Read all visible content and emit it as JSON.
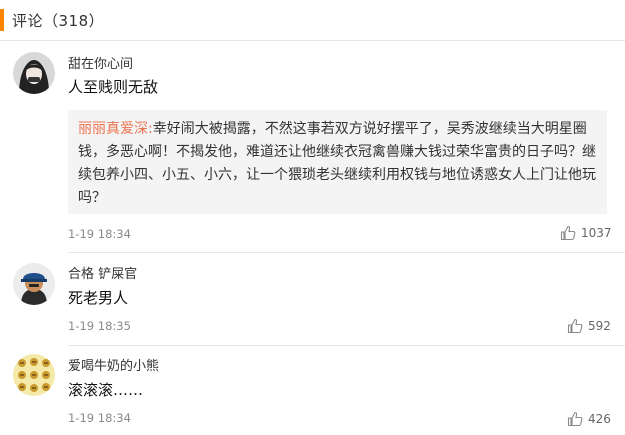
{
  "header": {
    "title": "评论（318）"
  },
  "comments": [
    {
      "username": "甜在你心间",
      "text": "人至贱则无敌",
      "reply": {
        "author": "丽丽真爱深:",
        "text": "幸好闹大被揭露，不然这事若双方说好摆平了，吴秀波继续当大明星圈钱，多恶心啊！不揭发他，难道还让他继续衣冠禽兽赚大钱过荣华富贵的日子吗？继续包养小四、小五、小六，让一个猥琐老头继续利用权钱与地位诱惑女人上门让他玩吗？"
      },
      "time": "1-19 18:34",
      "likes": "1037"
    },
    {
      "username": "合格  铲屎官",
      "text": "死老男人",
      "time": "1-19 18:35",
      "likes": "592"
    },
    {
      "username": "爱喝牛奶的小熊",
      "text": "滚滚滚……",
      "time": "1-19 18:34",
      "likes": "426"
    }
  ],
  "icons": {
    "like": "thumbs-up-icon",
    "avatar": "avatar"
  },
  "colors": {
    "accent": "#ff8200",
    "reply_author": "#eb7350",
    "reply_bg": "#f4f4f4"
  }
}
